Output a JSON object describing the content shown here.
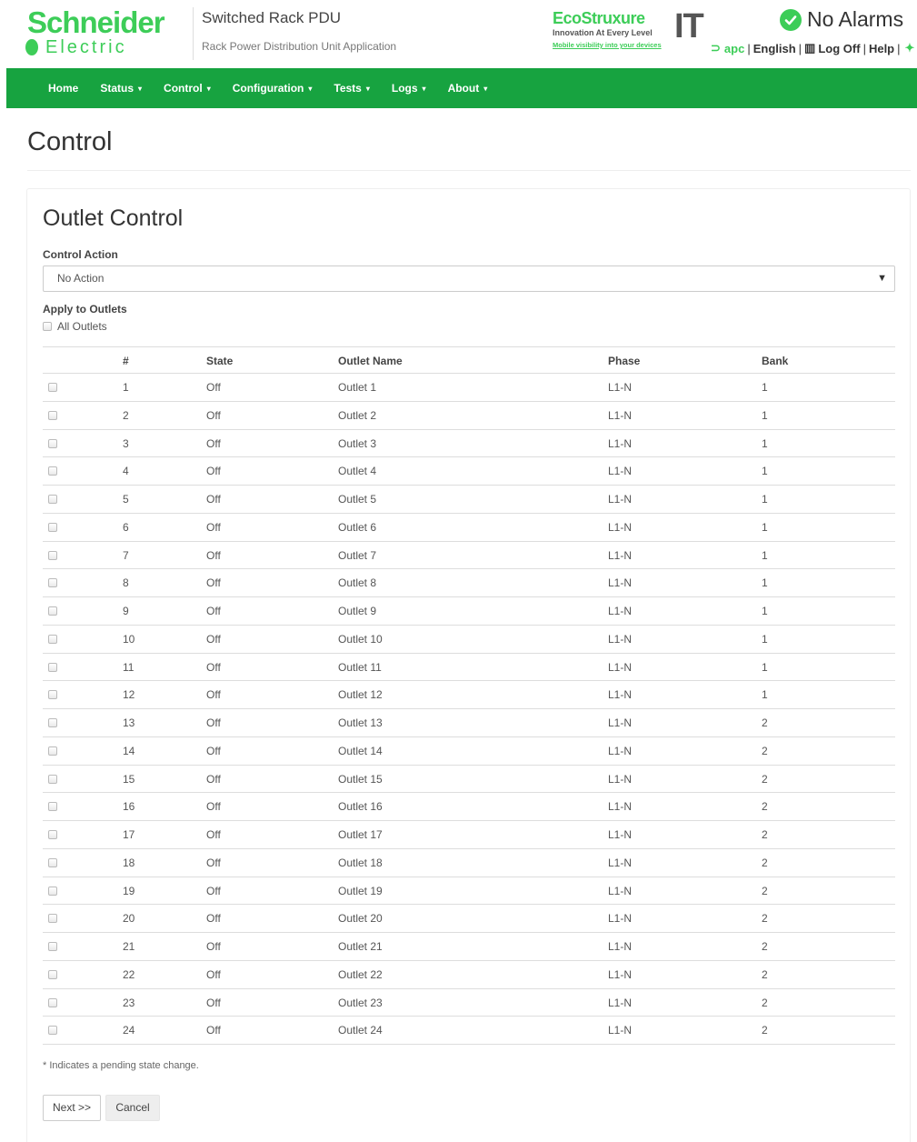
{
  "brand": {
    "line1": "Schneider",
    "line2": "Electric"
  },
  "app": {
    "title": "Switched Rack PDU",
    "subtitle": "Rack Power Distribution Unit Application"
  },
  "ecostruxure": {
    "name": "EcoStruxure",
    "tagline": "Innovation At Every Level",
    "link": "Mobile visibility into your devices",
    "it": "IT"
  },
  "status": {
    "alarms": "No Alarms"
  },
  "toplinks": {
    "user": "apc",
    "language": "English",
    "logoff": "Log Off",
    "help": "Help"
  },
  "nav": [
    {
      "label": "Home",
      "caret": false
    },
    {
      "label": "Status",
      "caret": true
    },
    {
      "label": "Control",
      "caret": true
    },
    {
      "label": "Configuration",
      "caret": true
    },
    {
      "label": "Tests",
      "caret": true
    },
    {
      "label": "Logs",
      "caret": true
    },
    {
      "label": "About",
      "caret": true
    }
  ],
  "page": {
    "title": "Control"
  },
  "panel": {
    "title": "Outlet Control",
    "control_action_label": "Control Action",
    "control_action_value": "No Action",
    "apply_label": "Apply to Outlets",
    "all_outlets_label": "All Outlets"
  },
  "table": {
    "columns": [
      "#",
      "State",
      "Outlet Name",
      "Phase",
      "Bank"
    ],
    "rows": [
      [
        "1",
        "Off",
        "Outlet 1",
        "L1-N",
        "1"
      ],
      [
        "2",
        "Off",
        "Outlet 2",
        "L1-N",
        "1"
      ],
      [
        "3",
        "Off",
        "Outlet 3",
        "L1-N",
        "1"
      ],
      [
        "4",
        "Off",
        "Outlet 4",
        "L1-N",
        "1"
      ],
      [
        "5",
        "Off",
        "Outlet 5",
        "L1-N",
        "1"
      ],
      [
        "6",
        "Off",
        "Outlet 6",
        "L1-N",
        "1"
      ],
      [
        "7",
        "Off",
        "Outlet 7",
        "L1-N",
        "1"
      ],
      [
        "8",
        "Off",
        "Outlet 8",
        "L1-N",
        "1"
      ],
      [
        "9",
        "Off",
        "Outlet 9",
        "L1-N",
        "1"
      ],
      [
        "10",
        "Off",
        "Outlet 10",
        "L1-N",
        "1"
      ],
      [
        "11",
        "Off",
        "Outlet 11",
        "L1-N",
        "1"
      ],
      [
        "12",
        "Off",
        "Outlet 12",
        "L1-N",
        "1"
      ],
      [
        "13",
        "Off",
        "Outlet 13",
        "L1-N",
        "2"
      ],
      [
        "14",
        "Off",
        "Outlet 14",
        "L1-N",
        "2"
      ],
      [
        "15",
        "Off",
        "Outlet 15",
        "L1-N",
        "2"
      ],
      [
        "16",
        "Off",
        "Outlet 16",
        "L1-N",
        "2"
      ],
      [
        "17",
        "Off",
        "Outlet 17",
        "L1-N",
        "2"
      ],
      [
        "18",
        "Off",
        "Outlet 18",
        "L1-N",
        "2"
      ],
      [
        "19",
        "Off",
        "Outlet 19",
        "L1-N",
        "2"
      ],
      [
        "20",
        "Off",
        "Outlet 20",
        "L1-N",
        "2"
      ],
      [
        "21",
        "Off",
        "Outlet 21",
        "L1-N",
        "2"
      ],
      [
        "22",
        "Off",
        "Outlet 22",
        "L1-N",
        "2"
      ],
      [
        "23",
        "Off",
        "Outlet 23",
        "L1-N",
        "2"
      ],
      [
        "24",
        "Off",
        "Outlet 24",
        "L1-N",
        "2"
      ]
    ]
  },
  "footer_note": "* Indicates a pending state change.",
  "buttons": {
    "next": "Next >>",
    "cancel": "Cancel"
  },
  "colors": {
    "brand_green": "#3dcd58",
    "nav_green": "#17a340"
  }
}
